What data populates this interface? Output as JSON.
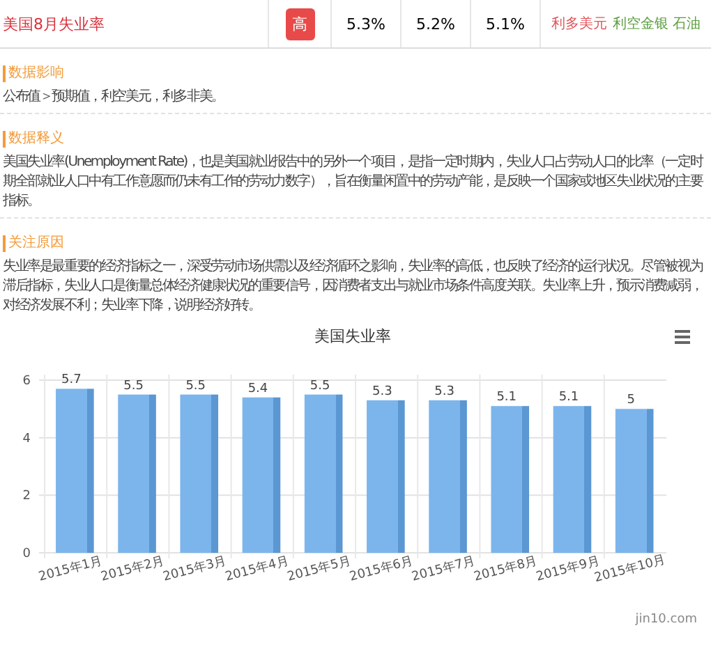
{
  "indicator": {
    "title": "美国8月失业率",
    "importance": "高",
    "previous": "5.3%",
    "forecast": "5.2%",
    "actual": "5.1%",
    "effects": [
      {
        "text": "利多美元",
        "kind": "bullish"
      },
      {
        "text": "利空金银 石油",
        "kind": "bearish"
      }
    ]
  },
  "sections": [
    {
      "heading": "数据影响",
      "text": "公布值＞预期值，利空美元，利多非美。"
    },
    {
      "heading": "数据释义",
      "text": "美国失业率(Unemployment Rate)，也是美国就业报告中的另外一个项目，是指一定时期内，失业人口占劳动人口的比率（一定时期全部就业人口中有工作意愿而仍未有工作的劳动力数字），旨在衡量闲置中的劳动产能，是反映一个国家或地区失业状况的主要指标。"
    },
    {
      "heading": "关注原因",
      "text": "失业率是最重要的经济指标之一，深受劳动市场供需以及经济循环之影响，失业率的高低，也反映了经济的运行状况。尽管被视为滞后指标，失业人口是衡量总体经济健康状况的重要信号，因消费者支出与就业市场条件高度关联。失业率上升，预示消费减弱，对经济发展不利；失业率下降，说明经济好转。"
    }
  ],
  "chart": {
    "credit": "jin10.com",
    "chart_data": {
      "type": "bar",
      "title": "美国失业率",
      "categories": [
        "2015年1月",
        "2015年2月",
        "2015年3月",
        "2015年4月",
        "2015年5月",
        "2015年6月",
        "2015年7月",
        "2015年8月",
        "2015年9月",
        "2015年10月"
      ],
      "values": [
        5.7,
        5.5,
        5.5,
        5.4,
        5.5,
        5.3,
        5.3,
        5.1,
        5.1,
        5
      ],
      "yticks": [
        0,
        2,
        4,
        6
      ],
      "ylim": [
        0,
        6
      ],
      "data_labels": true
    }
  }
}
